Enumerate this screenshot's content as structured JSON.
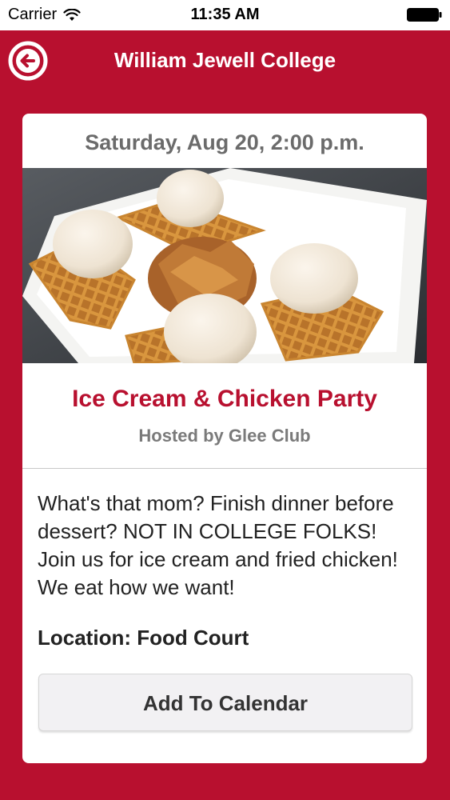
{
  "status_bar": {
    "carrier": "Carrier",
    "time": "11:35 AM",
    "wifi_icon": "wifi-icon",
    "battery_icon": "battery-icon"
  },
  "nav": {
    "title": "William Jewell College",
    "back_icon": "back-arrow-circle-icon"
  },
  "event": {
    "date": "Saturday, Aug 20, 2:00 p.m.",
    "image": "photo of waffles with ice cream scoops and fried chicken on a white plate",
    "title": "Ice Cream & Chicken Party",
    "host": "Hosted by Glee Club",
    "description": "What's that mom? Finish dinner before dessert? NOT IN COLLEGE FOLKS! Join us for ice cream and fried chicken! We eat how we want!",
    "location": "Location: Food Court",
    "calendar_button_label": "Add To Calendar"
  },
  "colors": {
    "brand": "#b8102f",
    "card": "#ffffff",
    "button": "#f2f1f3"
  }
}
